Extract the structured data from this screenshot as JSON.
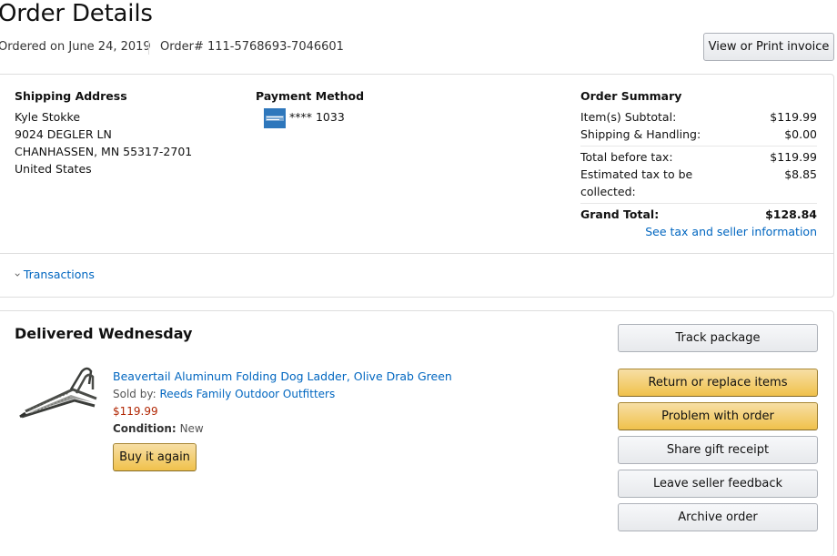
{
  "header": {
    "title": "Order Details",
    "ordered_on": "Ordered on June 24, 2019",
    "order_number": "Order# 111-5768693-7046601",
    "invoice_button": "View or Print invoice"
  },
  "shipping": {
    "heading": "Shipping Address",
    "lines": [
      "Kyle Stokke",
      "9024 DEGLER LN",
      "CHANHASSEN, MN 55317-2701",
      "United States"
    ]
  },
  "payment": {
    "heading": "Payment Method",
    "card_icon": "american-express-card-icon",
    "card_masked": "**** 1033"
  },
  "summary": {
    "heading": "Order Summary",
    "subtotal_label": "Item(s) Subtotal:",
    "subtotal_value": "$119.99",
    "shipping_label": "Shipping & Handling:",
    "shipping_value": "$0.00",
    "before_tax_label": "Total before tax:",
    "before_tax_value": "$119.99",
    "tax_label_1": "Estimated tax to be",
    "tax_label_2": "collected:",
    "tax_value": "$8.85",
    "grand_label": "Grand Total:",
    "grand_value": "$128.84",
    "tax_link": "See tax and seller information"
  },
  "transactions": {
    "chevron": "›",
    "label": "Transactions"
  },
  "shipment": {
    "status": "Delivered Wednesday",
    "item": {
      "title": "Beavertail Aluminum Folding Dog Ladder, Olive Drab Green",
      "sold_by_prefix": "Sold by: ",
      "seller": "Reeds Family Outdoor Outfitters",
      "price": "$119.99",
      "condition_label": "Condition:",
      "condition_value": "New",
      "buy_again": "Buy it again"
    },
    "actions": {
      "track": "Track package",
      "return": "Return or replace items",
      "problem": "Problem with order",
      "gift": "Share gift receipt",
      "feedback": "Leave seller feedback",
      "archive": "Archive order"
    }
  },
  "colors": {
    "link": "#0066c0",
    "price": "#b12704",
    "yellow_button": "#f0c14b",
    "amex_blue": "#2e77bc"
  }
}
